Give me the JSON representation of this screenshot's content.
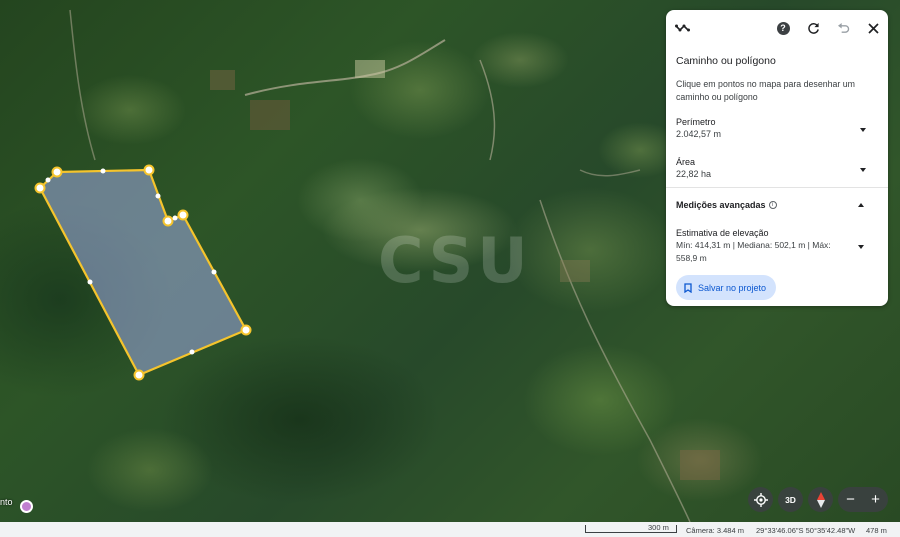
{
  "map": {
    "watermark": "CSU",
    "left_label": "nto"
  },
  "panel": {
    "title": "Caminho ou polígono",
    "instructions": "Clique em pontos no mapa para desenhar um caminho ou polígono",
    "perimeter": {
      "label": "Perímetro",
      "value": "2.042,57 m"
    },
    "area": {
      "label": "Área",
      "value": "22,82 ha"
    },
    "advanced": {
      "label": "Medições avançadas"
    },
    "elevation": {
      "label": "Estimativa de elevação",
      "value": "Mín: 414,31 m | Mediana: 502,1 m | Máx: 558,9 m"
    },
    "save_button": "Salvar no projeto",
    "icons": [
      "path-icon",
      "help-icon",
      "refresh-icon",
      "undo-icon",
      "close-icon"
    ],
    "help_glyph": "?"
  },
  "controls": {
    "three_d": "3D",
    "zoom_out": "−",
    "zoom_in": "+"
  },
  "status": {
    "scale": "300 m",
    "camera": "Câmera: 3.484 m",
    "coordinates": "29°33'46.06\"S 50°35'42.48\"W",
    "elevation": "478 m"
  },
  "colors": {
    "polygon_stroke": "#f5c42c",
    "polygon_fill": "rgba(160,170,230,0.55)",
    "button_bg": "#d3e3fd",
    "button_text": "#0b57d0"
  }
}
